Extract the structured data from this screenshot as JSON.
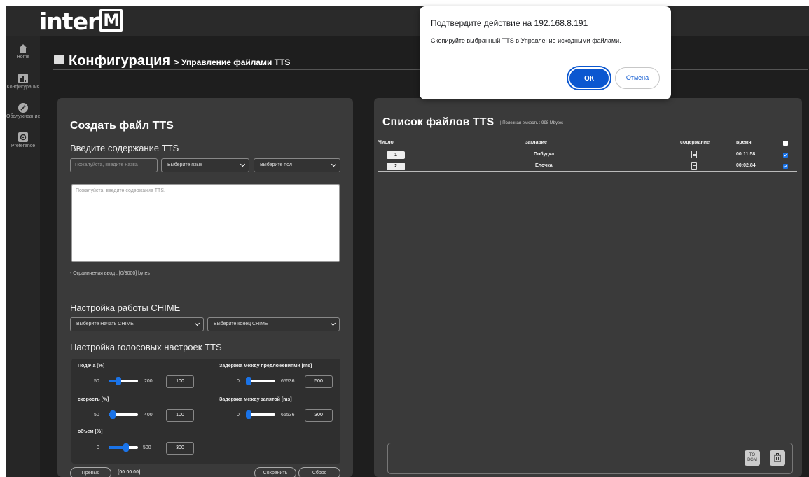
{
  "brand": {
    "logo_text": "inter",
    "logo_mark": "M"
  },
  "sidebar": {
    "items": [
      {
        "label": "Home",
        "icon": "home-icon"
      },
      {
        "label": "Конфигурация",
        "icon": "chart-icon"
      },
      {
        "label": "Обслуживание",
        "icon": "wrench-icon"
      },
      {
        "label": "Preference",
        "icon": "gear-icon"
      }
    ]
  },
  "header": {
    "title": "Конфигурация",
    "breadcrumb": "> Управление файлами TTS"
  },
  "create": {
    "title": "Создать файл TTS",
    "content_heading": "Введите содержание TTS",
    "name_placeholder": "Пожалуйста, введите назва",
    "language_select": "Выберите язык",
    "gender_select": "Выберите пол",
    "textarea_placeholder": "Пожалуйста, введите содержание TTS.",
    "limit_text": "- Ограничения ввод : [0/3000] bytes",
    "chime_heading": "Настройка работы CHIME",
    "chime_start_select": "Выберите Начать CHIME",
    "chime_end_select": "Выберите конец CHIME",
    "voice_heading": "Настройка голосовых настроек TTS",
    "voice": {
      "pitch": {
        "label": "Подача [%]",
        "min": "50",
        "max": "200",
        "value": "100",
        "fraction": 0.33
      },
      "speed": {
        "label": "скорость [%]",
        "min": "50",
        "max": "400",
        "value": "100",
        "fraction": 0.14
      },
      "volume": {
        "label": "объем [%]",
        "min": "0",
        "max": "500",
        "value": "300",
        "fraction": 0.6
      },
      "sentence_delay": {
        "label": "Задержка между предложениями [ms]",
        "min": "0",
        "max": "65536",
        "value": "500",
        "fraction": 0.01
      },
      "comma_delay": {
        "label": "Задержка между запятой [ms]",
        "min": "0",
        "max": "65536",
        "value": "300",
        "fraction": 0.005
      }
    },
    "preview_label": "Превью",
    "preview_time": "[00:00.00]",
    "save_label": "Сохранить",
    "reset_label": "Сброс"
  },
  "list": {
    "title": "Список файлов TTS",
    "capacity": "| Полезная емкость : 998 Mbytes",
    "columns": {
      "number": "Число",
      "title": "заглавие",
      "content": "содержание",
      "time": "время"
    },
    "rows": [
      {
        "number": "1",
        "title": "Побудка",
        "time": "00:11.58",
        "checked": true
      },
      {
        "number": "2",
        "title": "Елочка",
        "time": "00:02.84",
        "checked": true
      }
    ],
    "to_bgm_label": "TO BGM"
  },
  "dialog": {
    "title": "Подтвердите действие на 192.168.8.191",
    "message": "Скопируйте выбранный TTS в Управление исходными файлами.",
    "ok_label": "ОК",
    "cancel_label": "Отмена"
  },
  "colors": {
    "accent": "#1a73e8",
    "dialog_primary": "#0b57d0",
    "panel": "#3a3a3a",
    "background": "#1e1e1e"
  }
}
